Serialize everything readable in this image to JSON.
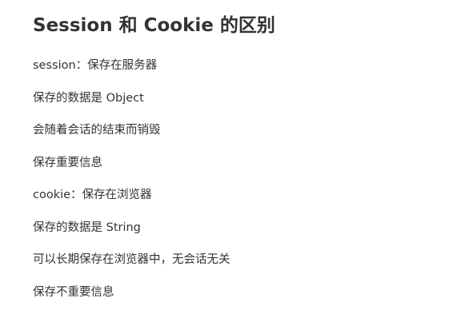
{
  "document": {
    "title": "Session 和 Cookie 的区别",
    "lines": [
      "session：保存在服务器",
      "保存的数据是 Object",
      "会随着会话的结束而销毁",
      "保存重要信息",
      "cookie：保存在浏览器",
      "保存的数据是 String",
      "可以长期保存在浏览器中，无会话无关",
      "保存不重要信息"
    ]
  },
  "colors": {
    "text": "#333333",
    "background": "#ffffff"
  }
}
